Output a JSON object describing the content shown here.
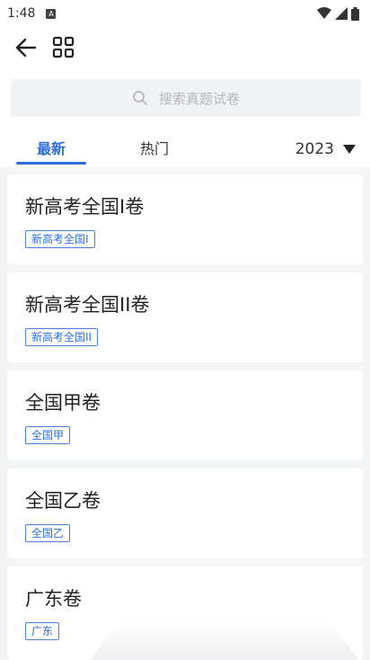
{
  "status_bar": {
    "time": "1:48",
    "app_icon_letter": "A"
  },
  "search": {
    "placeholder": "搜索真题试卷"
  },
  "tabs": [
    {
      "label": "最新"
    },
    {
      "label": "热门"
    }
  ],
  "year_filter": {
    "value": "2023"
  },
  "cards": [
    {
      "title": "新高考全国I卷",
      "tag": "新高考全国I"
    },
    {
      "title": "新高考全国II卷",
      "tag": "新高考全国II"
    },
    {
      "title": "全国甲卷",
      "tag": "全国甲"
    },
    {
      "title": "全国乙卷",
      "tag": "全国乙"
    },
    {
      "title": "广东卷",
      "tag": "广东"
    }
  ],
  "colors": {
    "accent": "#2f6fd6",
    "background": "#f4f5f7"
  }
}
